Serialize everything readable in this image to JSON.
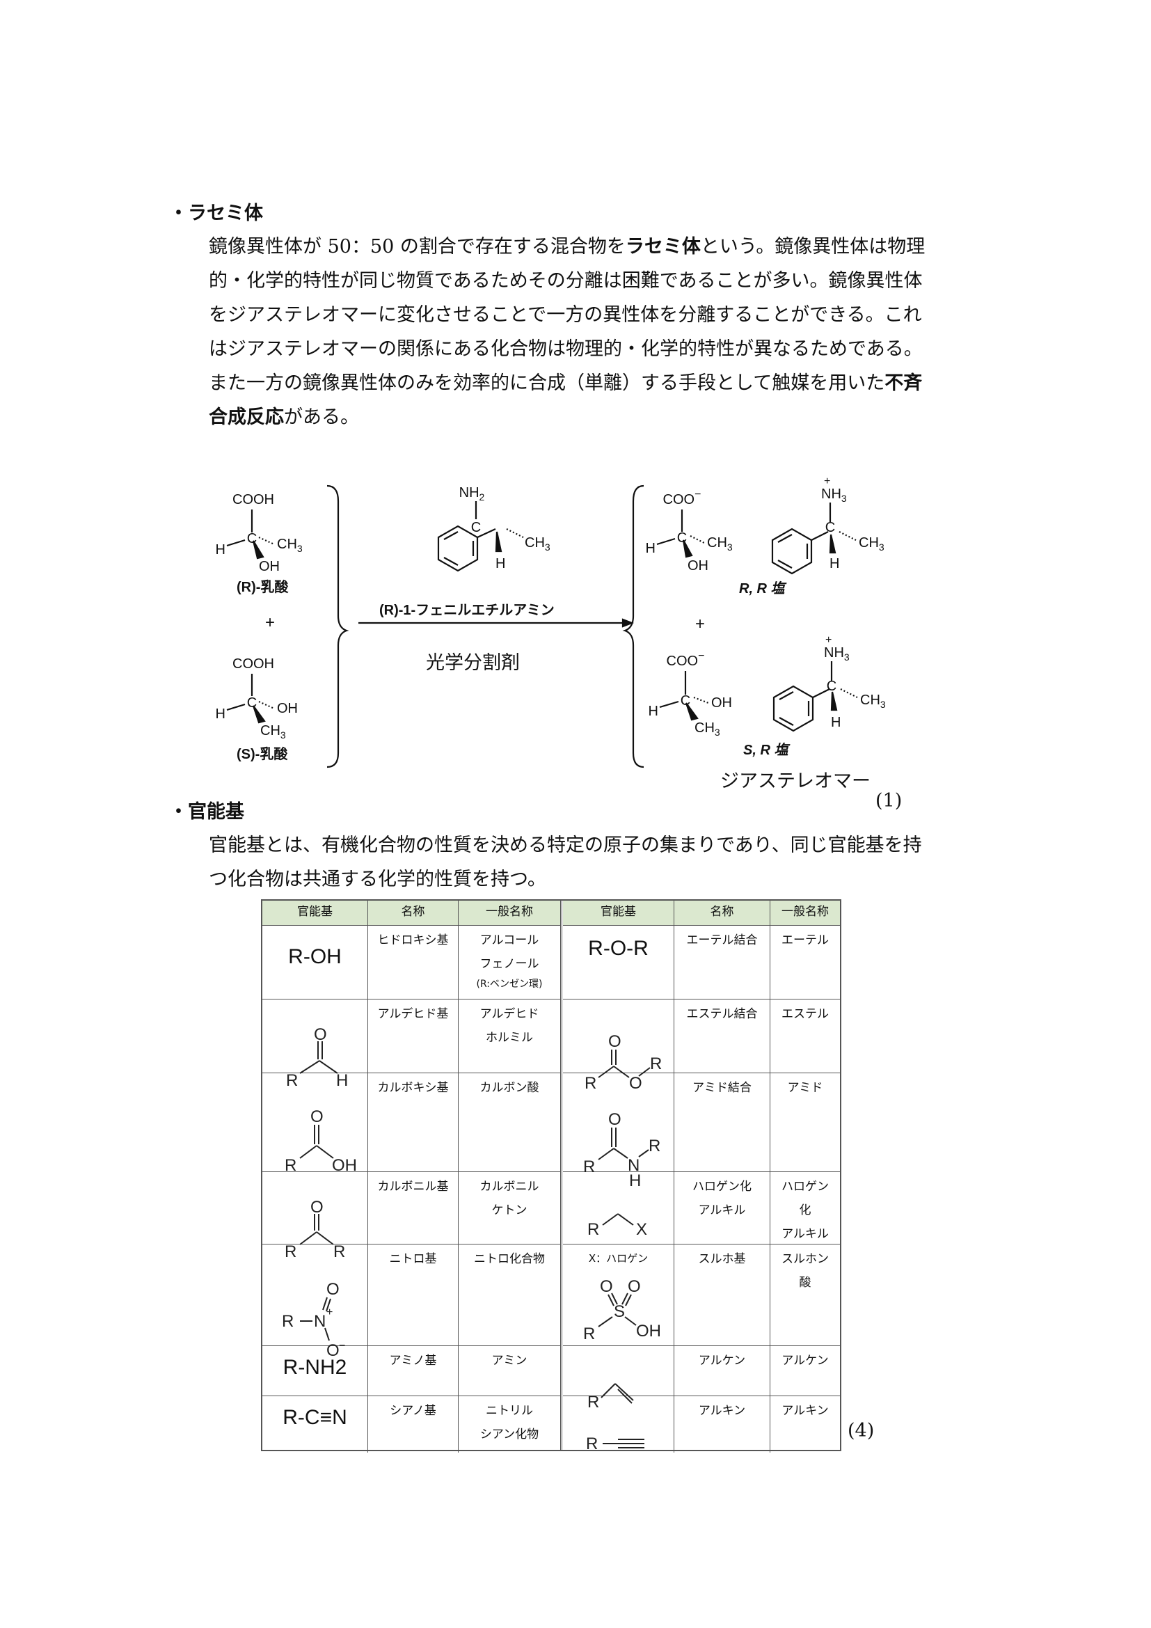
{
  "section1": {
    "heading": "・ラセミ体",
    "lines": [
      {
        "pre": "鏡像異性体が 50：50 の割合で存在する混合物を",
        "bold": "ラセミ体",
        "post": "という。鏡像異性体は物理"
      },
      {
        "pre": "的・化学的特性が同じ物質であるためその分離は困難であることが多い。鏡像異性体",
        "bold": "",
        "post": ""
      },
      {
        "pre": "をジアステレオマーに変化させることで一方の異性体を分離することができる。これ",
        "bold": "",
        "post": ""
      },
      {
        "pre": "はジアステレオマーの関係にある化合物は物理的・化学的特性が異なるためである。",
        "bold": "",
        "post": ""
      },
      {
        "pre": "また一方の鏡像異性体のみを効率的に合成（単離）する手段として触媒を用いた",
        "bold": "不斉",
        "post": ""
      },
      {
        "pre": "",
        "bold": "合成反応",
        "post": "がある。"
      }
    ]
  },
  "scheme": {
    "r_lactic": "(R)-乳酸",
    "s_lactic": "(S)-乳酸",
    "plus": "+",
    "reagent": "(R)-1-フェニルエチルアミン",
    "resolving_agent": "光学分割剤",
    "rr_salt": "R, R 塩",
    "sr_salt": "S, R 塩",
    "diastereomer": "ジアステレオマー",
    "ref": "(1)",
    "atoms": {
      "cooh": "COOH",
      "coo": "COO",
      "minus": "−",
      "h": "H",
      "c": "C",
      "ch3": "CH",
      "sub3": "3",
      "oh": "OH",
      "nh": "NH",
      "sub2": "2",
      "plus_charge": "+"
    }
  },
  "section2": {
    "heading": "・官能基",
    "lines": [
      "官能基とは、有機化合物の性質を決める特定の原子の集まりであり、同じ官能基を持",
      "つ化合物は共通する化学的性質を持つ。"
    ]
  },
  "table": {
    "headers": [
      "官能基",
      "名称",
      "一般名称"
    ],
    "left": [
      {
        "formula": "R-OH",
        "name": "ヒドロキシ基",
        "general": "アルコール\nフェノール",
        "note": "(R:ベンゼン環)"
      },
      {
        "formula": "",
        "name": "アルデヒド基",
        "general": "アルデヒド\nホルミル"
      },
      {
        "formula": "",
        "name": "カルボキシ基",
        "general": "カルボン酸"
      },
      {
        "formula": "",
        "name": "カルボニル基",
        "general": "カルボニル\nケトン"
      },
      {
        "formula": "",
        "name": "ニトロ基",
        "general": "ニトロ化合物"
      },
      {
        "formula": "R-NH2",
        "name": "アミノ基",
        "general": "アミン"
      },
      {
        "formula": "R-C≡N",
        "name": "シアノ基",
        "general": "ニトリル\nシアン化物"
      }
    ],
    "right": [
      {
        "formula": "R-O-R",
        "name": "エーテル結合",
        "general": "エーテル"
      },
      {
        "formula": "",
        "name": "エステル結合",
        "general": "エステル"
      },
      {
        "formula": "",
        "name": "アミド結合",
        "general": "アミド"
      },
      {
        "formula": "",
        "name": "ハロゲン化\nアルキル",
        "general": "ハロゲン\n化\nアルキル",
        "note": "X：ハロゲン"
      },
      {
        "formula": "",
        "name": "スルホ基",
        "general": "スルホン\n酸"
      },
      {
        "formula": "",
        "name": "アルケン",
        "general": "アルケン"
      },
      {
        "formula": "",
        "name": "アルキン",
        "general": "アルキン"
      }
    ],
    "atoms": {
      "r": "R",
      "o": "O",
      "h": "H",
      "oh": "OH",
      "n": "N",
      "s": "S",
      "x": "X",
      "plus": "+",
      "minus": "−"
    },
    "ref": "(4)"
  }
}
